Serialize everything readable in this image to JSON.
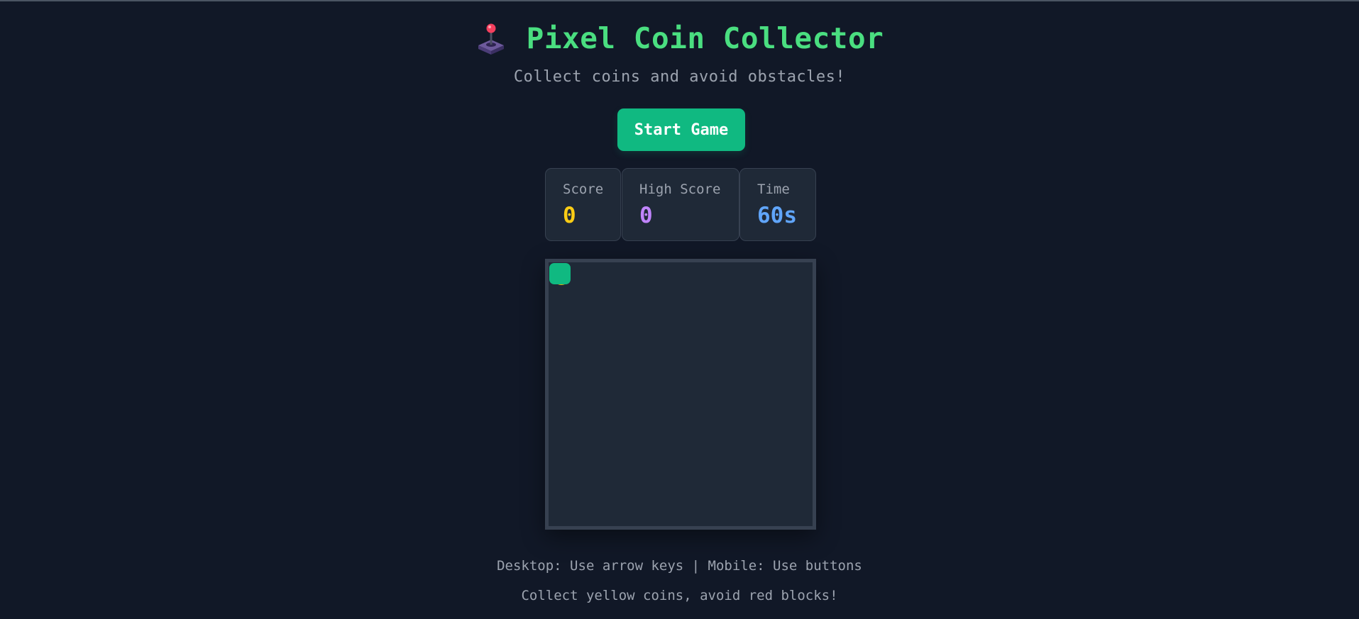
{
  "header": {
    "icon": "joystick-icon",
    "title": "Pixel Coin Collector",
    "subtitle": "Collect coins and avoid obstacles!"
  },
  "controls": {
    "start_label": "Start Game"
  },
  "stats": {
    "score": {
      "label": "Score",
      "value": "0",
      "color": "#facc15"
    },
    "high_score": {
      "label": "High Score",
      "value": "0",
      "color": "#c084fc"
    },
    "time": {
      "label": "Time",
      "value": "60s",
      "color": "#60a5fa"
    }
  },
  "board": {
    "player": "player-square",
    "coin": "coin",
    "colors": {
      "player": "#10b981",
      "coin": "#eab308",
      "board": "#1f2937",
      "border": "#374151"
    }
  },
  "instructions": {
    "line1": "Desktop: Use arrow keys | Mobile: Use buttons",
    "line2": "Collect yellow coins, avoid red blocks!"
  },
  "theme": {
    "background": "#111827",
    "accent": "#10b981",
    "title_color": "#4ade80"
  }
}
